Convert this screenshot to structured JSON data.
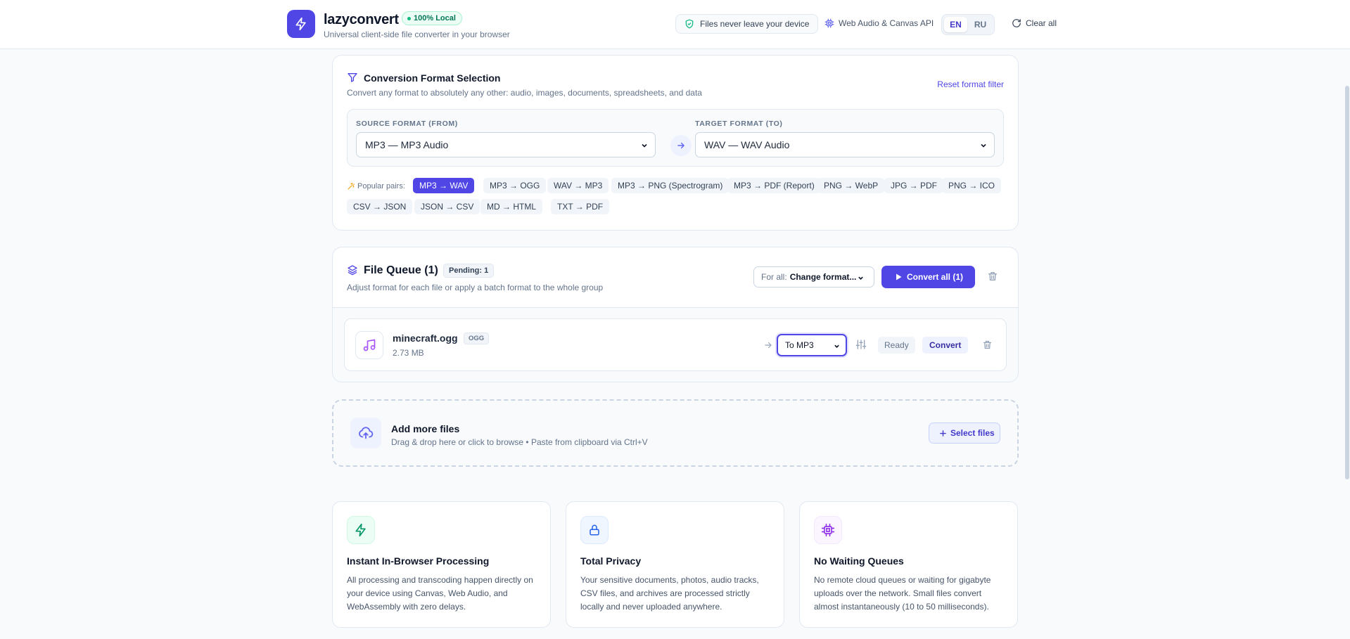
{
  "header": {
    "brand_name": "lazyconvert",
    "local_badge": "100% Local",
    "subtitle": "Universal client-side file converter in your browser",
    "privacy_pill": "Files never leave your device",
    "api_info": "Web Audio & Canvas API",
    "languages": [
      "EN",
      "RU"
    ],
    "active_language": "EN",
    "clear_all": "Clear all"
  },
  "format_selection": {
    "title": "Conversion Format Selection",
    "description": "Convert any format to absolutely any other: audio, images, documents, spreadsheets, and data",
    "reset_label": "Reset format filter",
    "source_label": "SOURCE FORMAT (FROM)",
    "source_value": "MP3 — MP3 Audio",
    "target_label": "TARGET FORMAT (TO)",
    "target_value": "WAV — WAV Audio",
    "popular_label": "Popular pairs:",
    "popular_pairs": [
      "MP3 → WAV",
      "MP3 → OGG",
      "WAV → MP3",
      "MP3 → PNG (Spectrogram)",
      "MP3 → PDF (Report)",
      "PNG → WebP",
      "JPG → PDF",
      "PNG → ICO",
      "CSV → JSON",
      "JSON → CSV",
      "MD → HTML",
      "TXT → PDF"
    ],
    "active_pair": "MP3 → WAV"
  },
  "queue": {
    "title": "File Queue (1)",
    "pending_badge": "Pending: 1",
    "description": "Adjust format for each file or apply a batch format to the whole group",
    "batch_label": "For all:",
    "batch_value": "Change format...",
    "convert_all_label": "Convert all (1)",
    "files": [
      {
        "name": "minecraft.ogg",
        "ext": "OGG",
        "size": "2.73 MB",
        "target": "To MP3",
        "status": "Ready",
        "convert_label": "Convert"
      }
    ]
  },
  "dropzone": {
    "title": "Add more files",
    "description": "Drag & drop here or click to browse • Paste from clipboard via Ctrl+V",
    "button_label": "Select files"
  },
  "features": [
    {
      "title": "Instant In-Browser Processing",
      "description": "All processing and transcoding happen directly on your device using Canvas, Web Audio, and WebAssembly with zero delays.",
      "icon": "bolt-icon",
      "color": "#059669",
      "bg": "#ecfdf5"
    },
    {
      "title": "Total Privacy",
      "description": "Your sensitive documents, photos, audio tracks, CSV files, and archives are processed strictly locally and never uploaded anywhere.",
      "icon": "lock-icon",
      "color": "#2563eb",
      "bg": "#eff6ff"
    },
    {
      "title": "No Waiting Queues",
      "description": "No remote cloud queues or waiting for gigabyte uploads over the network. Small files convert almost instantaneously (10 to 50 milliseconds).",
      "icon": "chip-icon",
      "color": "#9333ea",
      "bg": "#faf5ff"
    }
  ],
  "colors": {
    "accent": "#4f46e5",
    "success": "#10b981",
    "border": "#e2e8f0",
    "background": "#f8fafc"
  }
}
